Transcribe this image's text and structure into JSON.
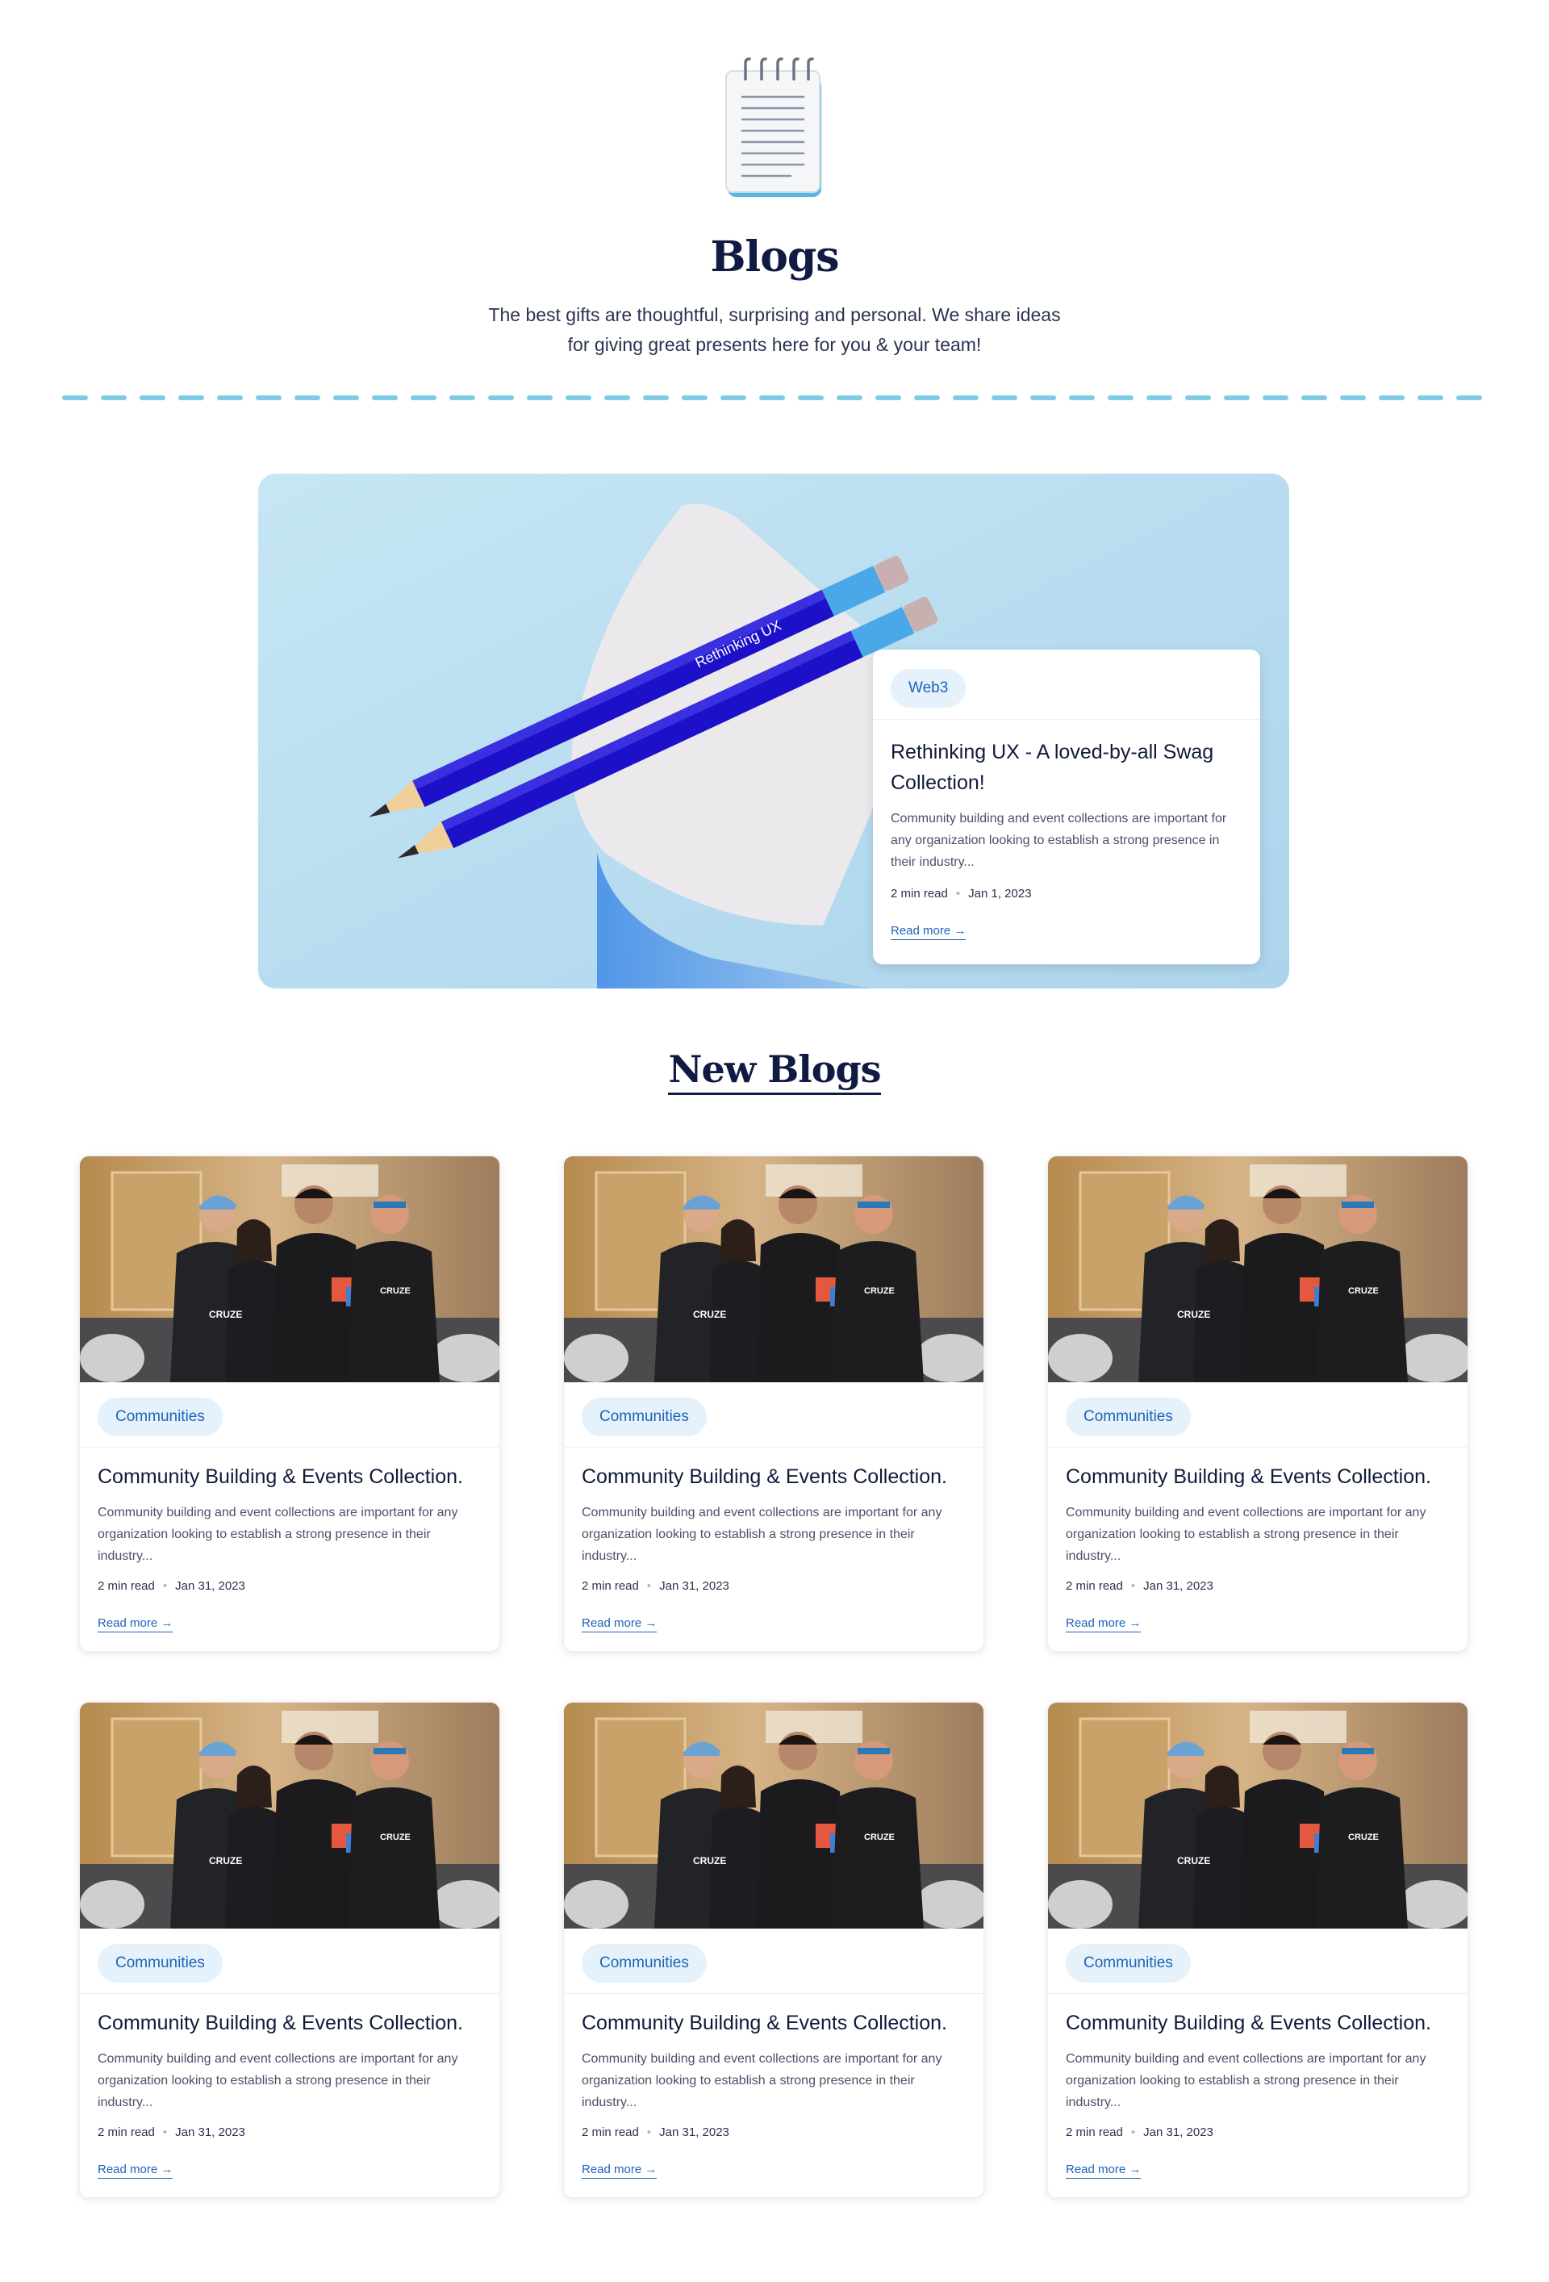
{
  "header": {
    "icon": "notepad-icon",
    "title": "Blogs",
    "subtitle_line1": "The best gifts are thoughtful, surprising and personal. We share ideas",
    "subtitle_line2": "for giving great presents here for you & your team!"
  },
  "featured": {
    "image": "pencils-image",
    "image_text": "Rethinking UX",
    "tag": "Web3",
    "title": "Rethinking UX - A loved-by-all Swag Collection!",
    "description": "Community building and event collections are important for any organization looking to establish a strong presence in their industry...",
    "read_time": "2 min read",
    "date": "Jan 1, 2023",
    "read_more": "Read more →"
  },
  "section_title": "New Blogs",
  "posts": [
    {
      "tag": "Communities",
      "title": "Community Building & Events Collection.",
      "description": "Community building and event collections are important for any organization looking to establish a strong presence in their industry...",
      "read_time": "2 min read",
      "date": "Jan 31, 2023",
      "read_more": "Read more →"
    },
    {
      "tag": "Communities",
      "title": "Community Building & Events Collection.",
      "description": "Community building and event collections are important for any organization looking to establish a strong presence in their industry...",
      "read_time": "2 min read",
      "date": "Jan 31, 2023",
      "read_more": "Read more →"
    },
    {
      "tag": "Communities",
      "title": "Community Building & Events Collection.",
      "description": "Community building and event collections are important for any organization looking to establish a strong presence in their industry...",
      "read_time": "2 min read",
      "date": "Jan 31, 2023",
      "read_more": "Read more →"
    },
    {
      "tag": "Communities",
      "title": "Community Building & Events Collection.",
      "description": "Community building and event collections are important for any organization looking to establish a strong presence in their industry...",
      "read_time": "2 min read",
      "date": "Jan 31, 2023",
      "read_more": "Read more →"
    },
    {
      "tag": "Communities",
      "title": "Community Building & Events Collection.",
      "description": "Community building and event collections are important for any organization looking to establish a strong presence in their industry...",
      "read_time": "2 min read",
      "date": "Jan 31, 2023",
      "read_more": "Read more →"
    },
    {
      "tag": "Communities",
      "title": "Community Building & Events Collection.",
      "description": "Community building and event collections are important for any organization looking to establish a strong presence in their industry...",
      "read_time": "2 min read",
      "date": "Jan 31, 2023",
      "read_more": "Read more →"
    }
  ],
  "photo_text": [
    "CRUZE",
    "CRUZE"
  ],
  "colors": {
    "accent": "#1d63b8",
    "tag_bg": "#e6f2fb",
    "heading": "#101a42",
    "divider": "#7fcbe6",
    "featured_bg": "#bcdff0"
  }
}
